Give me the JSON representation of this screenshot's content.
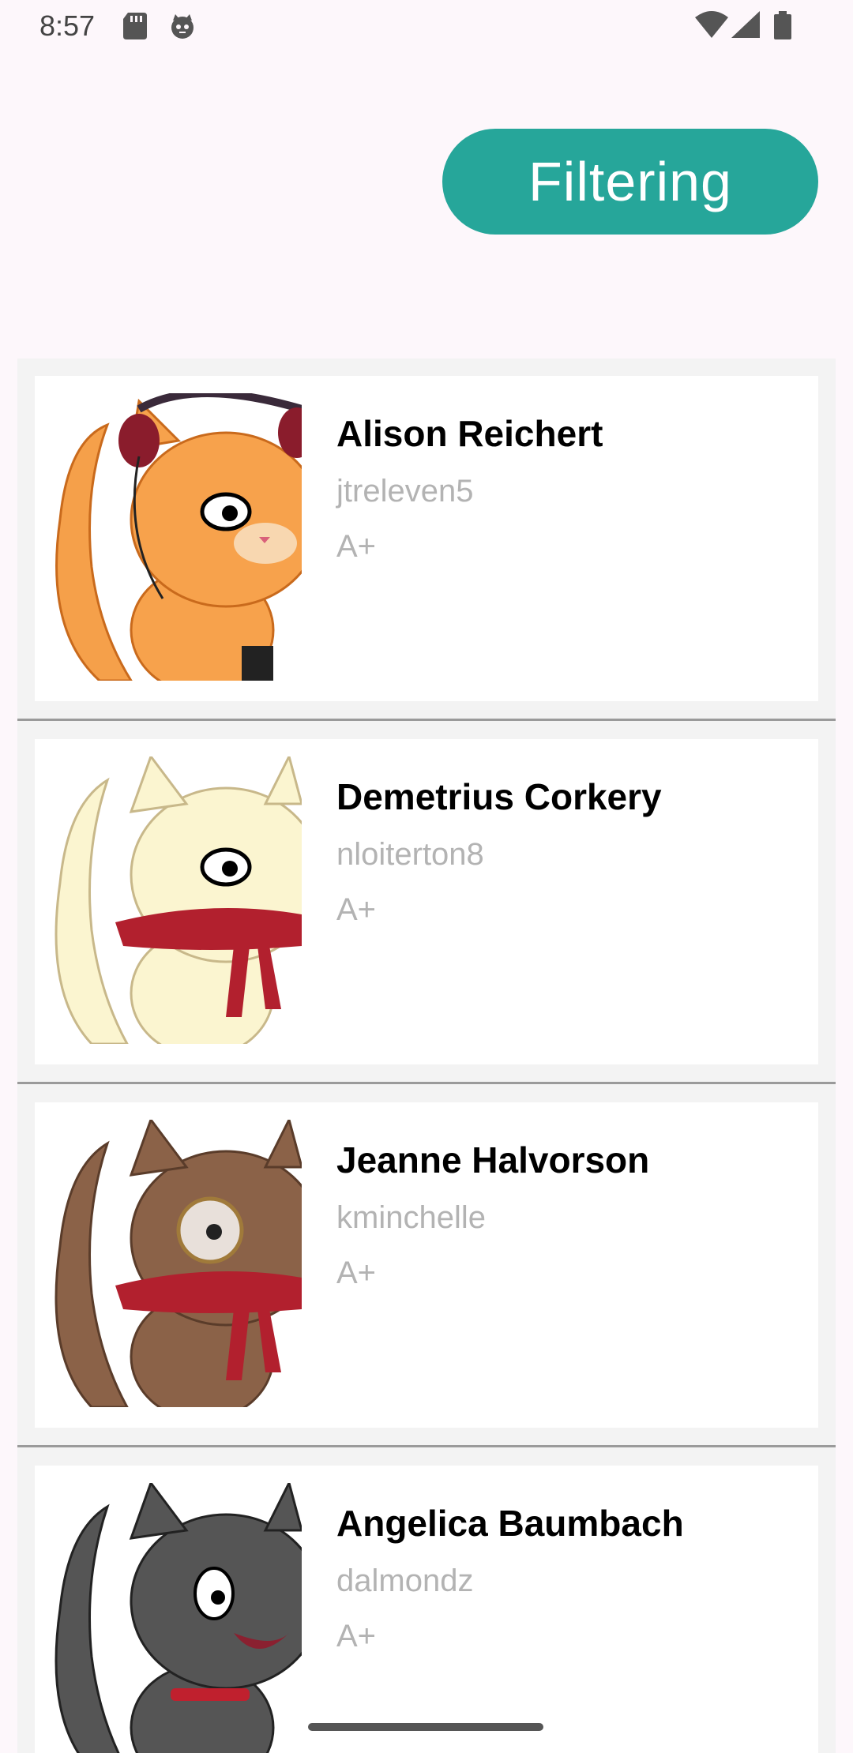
{
  "status_bar": {
    "time": "8:57",
    "icons": [
      "sd-card-icon",
      "cat-status-icon",
      "wifi-icon",
      "cell-signal-icon",
      "battery-icon"
    ]
  },
  "header": {
    "filter_button_label": "Filtering"
  },
  "colors": {
    "accent": "#26a69a",
    "background": "#fdf7fb",
    "list_background": "#f3f3f3",
    "secondary_text": "#b3b3b3"
  },
  "contacts": [
    {
      "name": "Alison Reichert",
      "username": "jtreleven5",
      "grade": "A+",
      "avatar": "orange-cat-headphones"
    },
    {
      "name": "Demetrius Corkery",
      "username": "nloiterton8",
      "grade": "A+",
      "avatar": "cream-cat-red-scarf"
    },
    {
      "name": "Jeanne Halvorson",
      "username": "kminchelle",
      "grade": "A+",
      "avatar": "brown-cat-monocle"
    },
    {
      "name": "Angelica Baumbach",
      "username": "dalmondz",
      "grade": "A+",
      "avatar": "gray-cat-red-collar"
    }
  ]
}
